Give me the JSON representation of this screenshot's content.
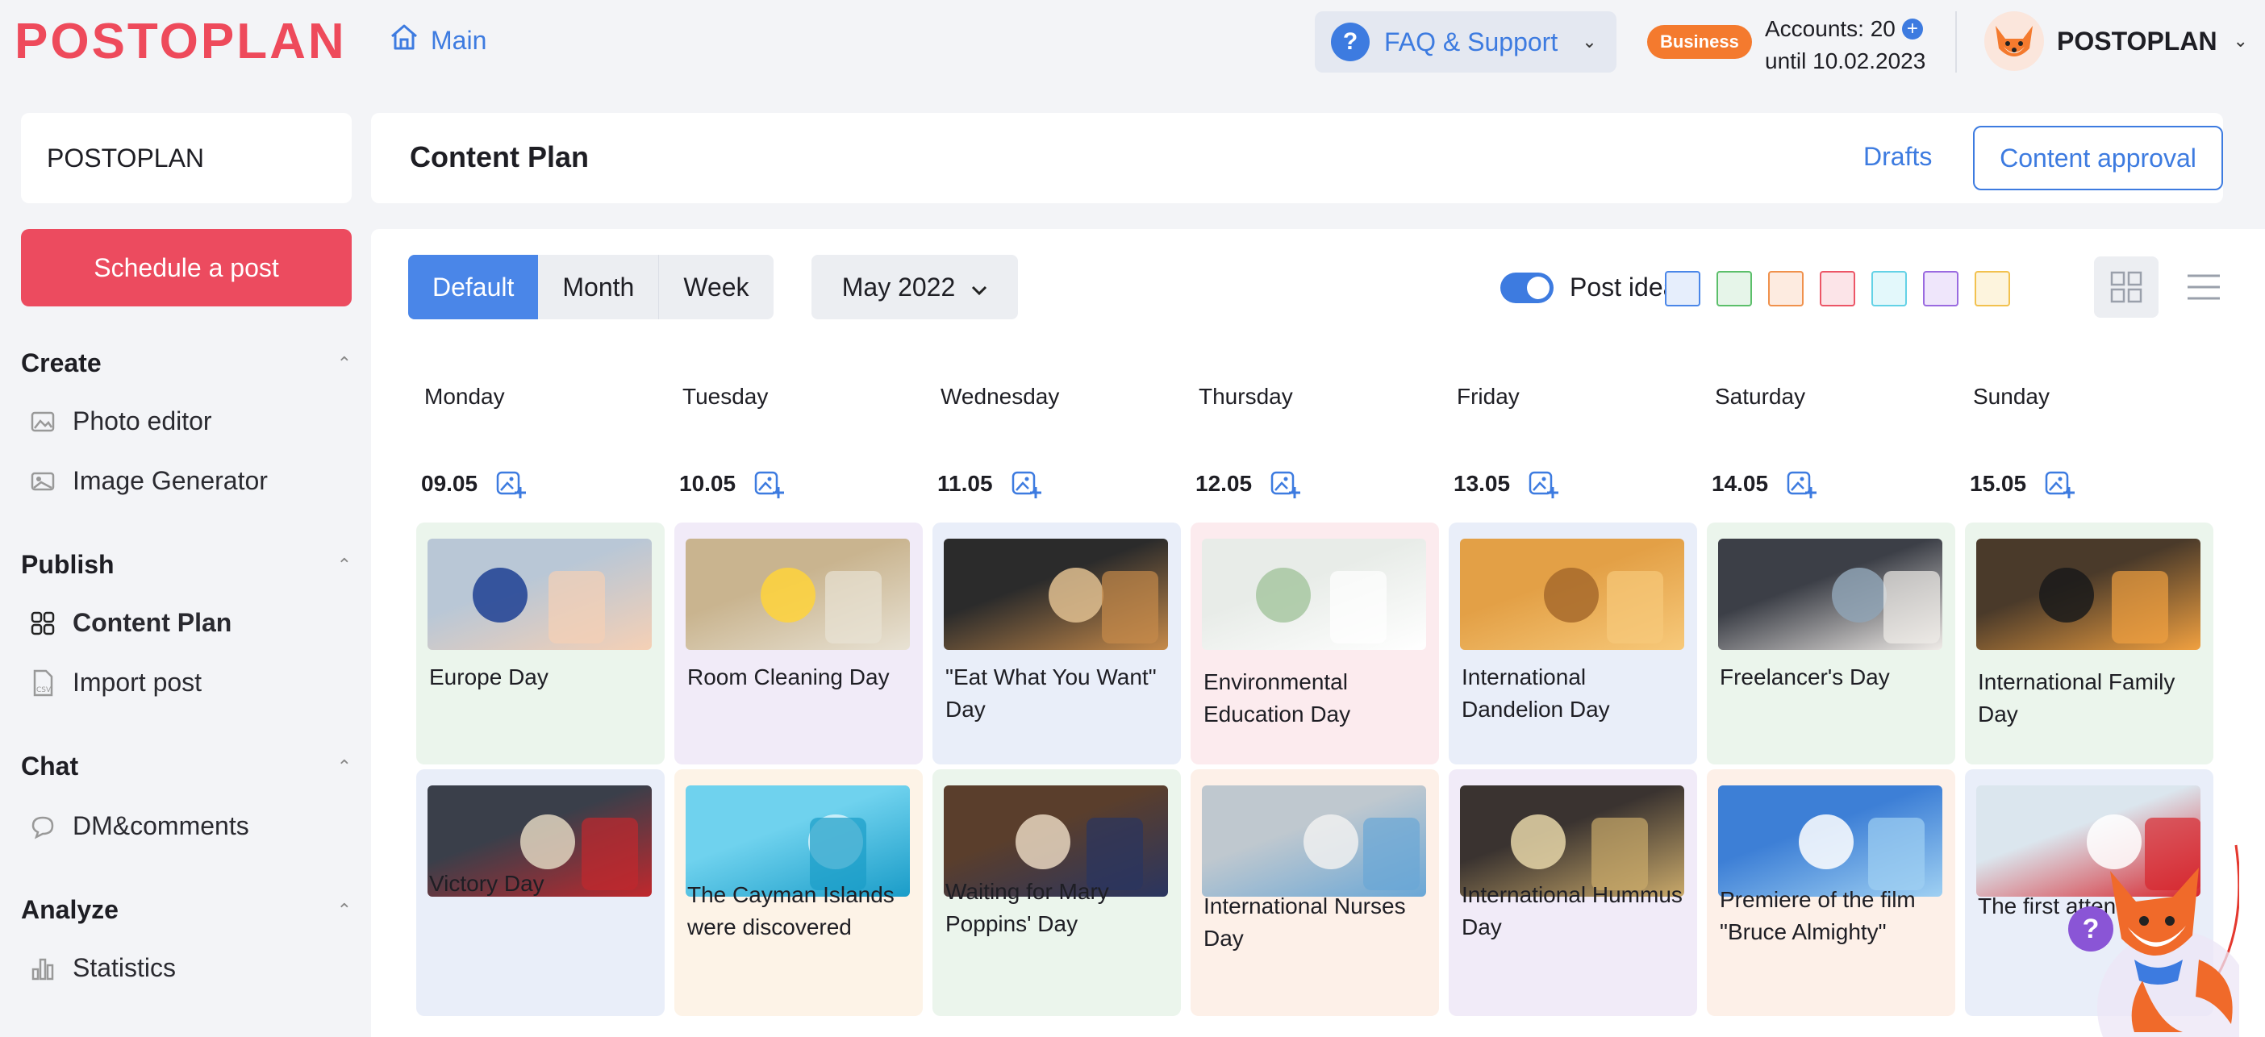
{
  "header": {
    "logo": "POSTOPLAN",
    "main_link": "Main",
    "faq": "FAQ & Support",
    "plan_badge": "Business",
    "accounts_line": "Accounts: 20",
    "until_line": "until 10.02.2023",
    "user_name": "POSTOPLAN"
  },
  "sidebar": {
    "workspace": "POSTOPLAN",
    "schedule_button": "Schedule a post",
    "sections": {
      "create": {
        "title": "Create",
        "items": [
          "Photo editor",
          "Image Generator"
        ]
      },
      "publish": {
        "title": "Publish",
        "items": [
          "Content Plan",
          "Import post"
        ]
      },
      "chat": {
        "title": "Chat",
        "items": [
          "DM&comments"
        ]
      },
      "analyze": {
        "title": "Analyze",
        "items": [
          "Statistics"
        ]
      }
    }
  },
  "content": {
    "title": "Content Plan",
    "drafts": "Drafts",
    "approval": "Content approval"
  },
  "toolbar": {
    "views": [
      "Default",
      "Month",
      "Week"
    ],
    "active_view": "Default",
    "month": "May 2022",
    "post_ideas_label": "Post ideas",
    "post_ideas_on": true,
    "swatch_colors": [
      "#4a86e8",
      "#5bbf6a",
      "#f0914c",
      "#ec5566",
      "#63d2e6",
      "#9a6ae0",
      "#f2c14e"
    ]
  },
  "calendar": {
    "days": [
      {
        "name": "Monday",
        "date": "09.05"
      },
      {
        "name": "Tuesday",
        "date": "10.05"
      },
      {
        "name": "Wednesday",
        "date": "11.05"
      },
      {
        "name": "Thursday",
        "date": "12.05"
      },
      {
        "name": "Friday",
        "date": "13.05"
      },
      {
        "name": "Saturday",
        "date": "14.05"
      },
      {
        "name": "Sunday",
        "date": "15.05"
      }
    ],
    "row1": [
      {
        "title": "Europe Day",
        "bg": "#ebf5ec"
      },
      {
        "title": "Room Cleaning Day",
        "bg": "#f1ebf8"
      },
      {
        "title": "\"Eat What You Want\" Day",
        "bg": "#e9eef9"
      },
      {
        "title": "Environmental Education Day",
        "bg": "#fcebee"
      },
      {
        "title": "International Dandelion Day",
        "bg": "#e9eef9"
      },
      {
        "title": "Freelancer's Day",
        "bg": "#ebf5ec"
      },
      {
        "title": "International Family Day",
        "bg": "#ebf5ec"
      }
    ],
    "row2": [
      {
        "title": "Victory Day",
        "bg": "#e9eef9"
      },
      {
        "title": "The Cayman Islands were discovered",
        "bg": "#fdf3e7"
      },
      {
        "title": "Waiting for Mary Poppins' Day",
        "bg": "#ebf5ec"
      },
      {
        "title": "International Nurses Day",
        "bg": "#fdf0e8"
      },
      {
        "title": "International Hummus Day",
        "bg": "#f1ebf8"
      },
      {
        "title": "Premiere of the film \"Bruce Almighty\"",
        "bg": "#fdf0e8"
      },
      {
        "title": "The first attendant a",
        "bg": "#e9eef9"
      }
    ]
  },
  "help_button": "?"
}
